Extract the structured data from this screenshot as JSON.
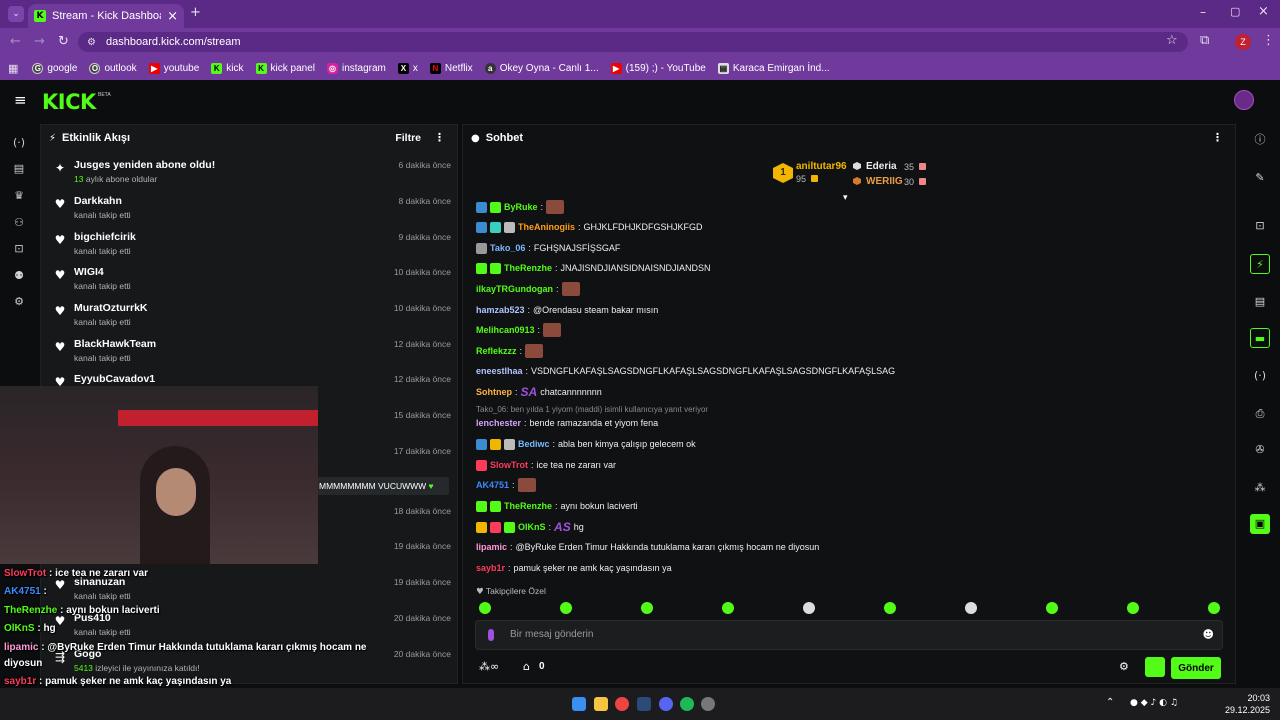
{
  "browser": {
    "tab_title": "Stream - Kick Dashboard",
    "url": "dashboard.kick.com/stream",
    "profile_letter": "Z",
    "bookmarks": [
      "google",
      "outlook",
      "youtube",
      "kick",
      "kick panel",
      "instagram",
      "x",
      "Netflix",
      "Okey Oyna - Canlı 1...",
      "(159) ;) - YouTube",
      "Karaca Emirgan İnd..."
    ]
  },
  "kick": {
    "logo": "KICK",
    "beta": "BETA"
  },
  "activity": {
    "title": "Etkinlik Akışı",
    "filter_label": "Filtre",
    "items": [
      {
        "name": "Jusges yeniden abone oldu!",
        "sub_count": "13",
        "sub": "aylık abone oldular",
        "time": "6 dakika önce",
        "icon": "sparkle-icon"
      },
      {
        "name": "Darkkahn",
        "sub": "kanalı takip etti",
        "time": "8 dakika önce",
        "icon": "heart-icon"
      },
      {
        "name": "bigchiefcirik",
        "sub": "kanalı takip etti",
        "time": "9 dakika önce",
        "icon": "heart-icon"
      },
      {
        "name": "WIGI4",
        "sub": "kanalı takip etti",
        "time": "10 dakika önce",
        "icon": "heart-icon"
      },
      {
        "name": "MuratOzturrkK",
        "sub": "kanalı takip etti",
        "time": "10 dakika önce",
        "icon": "heart-icon"
      },
      {
        "name": "BlackHawkTeam",
        "sub": "kanalı takip etti",
        "time": "12 dakika önce",
        "icon": "heart-icon"
      },
      {
        "name": "EyyubCavadov1",
        "sub": "",
        "time": "12 dakika önce",
        "icon": "heart-icon"
      },
      {
        "name": "",
        "sub": "",
        "time": "15 dakika önce",
        "icon": ""
      },
      {
        "name": "",
        "sub": "",
        "time": "17 dakika önce",
        "icon": ""
      },
      {
        "name": "",
        "sub": "",
        "time": "18 dakika önce",
        "icon": ""
      },
      {
        "name": "",
        "sub": "",
        "time": "19 dakika önce",
        "icon": ""
      },
      {
        "name": "sinanuzan",
        "sub": "kanalı takip etti",
        "time": "19 dakika önce",
        "icon": "heart-icon"
      },
      {
        "name": "Pus410",
        "sub": "kanalı takip etti",
        "time": "20 dakika önce",
        "icon": "heart-icon"
      },
      {
        "name": "Gogo",
        "sub_count": "5413",
        "sub": "izleyici ile yayınınıza katıldı!",
        "time": "20 dakika önce",
        "icon": "raid-icon"
      }
    ],
    "highlight_message": "MMMMMMMM VUCUWWW"
  },
  "chat": {
    "title": "Sohbet",
    "leaderboard": {
      "first_name": "aniltutar96",
      "first_rank": "1",
      "first_value": "95",
      "second_name": "Ederia",
      "second_value": "35",
      "third_name": "WERIIG",
      "third_value": "30"
    },
    "messages": [
      {
        "user": "ByRuke",
        "color": "#53fc18",
        "text": ""
      },
      {
        "user": "TheAninogiis",
        "color": "#ff9f1c",
        "text": "GHJKLFDHJKDFGSHJKFGD"
      },
      {
        "user": "Tako_06",
        "color": "#7ab8ff",
        "text": "FGHŞNAJSFİŞSGAF"
      },
      {
        "user": "TheRenzhe",
        "color": "#53fc18",
        "text": "JNAJISNDJIANSIDNAISNDJIANDSN"
      },
      {
        "user": "ilkayTRGundogan",
        "color": "#53fc18",
        "text": ""
      },
      {
        "user": "hamzab523",
        "color": "#b0c4ff",
        "text": "@Orendasu steam bakar mısın"
      },
      {
        "user": "Melihcan0913",
        "color": "#53fc18",
        "text": ""
      },
      {
        "user": "Reflekzzz",
        "color": "#53fc18",
        "text": ""
      },
      {
        "user": "eneestlhaa",
        "color": "#b0c4ff",
        "text": "VSDNGFLKAFAŞLSAGSDNGFLKAFAŞLSAGSDNGFLKAFAŞLSAGSDNGFLKAFAŞLSAG"
      },
      {
        "user": "Sohtnep",
        "color": "#ffb347",
        "text": "chatcannnnnnn"
      },
      {
        "user": "lenchester",
        "color": "#d6a0ff",
        "text": "bende ramazanda et yiyom fena"
      },
      {
        "user": "Bediwc",
        "color": "#7ab8ff",
        "text": "abla ben kimya çalışıp gelecem ok"
      },
      {
        "user": "SlowTrot",
        "color": "#ff3b5c",
        "text": "ice tea ne zararı var"
      },
      {
        "user": "AK4751",
        "color": "#3b8bff",
        "text": ""
      },
      {
        "user": "TheRenzhe",
        "color": "#53fc18",
        "text": "aynı bokun laciverti"
      },
      {
        "user": "OlKnS",
        "color": "#53fc18",
        "text": "hg"
      },
      {
        "user": "lipamic",
        "color": "#ff9ad6",
        "text": "@ByRuke Erden Timur Hakkında tutuklama kararı çıkmış hocam ne diyosun"
      },
      {
        "user": "sayb1r",
        "color": "#ff3b5c",
        "text": "pamuk şeker ne amk kaç yaşındasın ya"
      }
    ],
    "reply_context": "Tako_06: ben yılda 1 yiyom (maddi) isimli kullanıcıya yanıt veriyor",
    "emote_SA": "SA",
    "emote_AS": "AS",
    "followers_only": "Takipçilere Özel",
    "input_placeholder": "Bir mesaj gönderin",
    "bottom_count": "0",
    "send_label": "Gönder"
  },
  "overlay_chat": [
    {
      "user": "SlowTrot",
      "color": "#ff3b5c",
      "text": "ice tea ne zararı var"
    },
    {
      "user": "AK4751",
      "color": "#3b8bff",
      "text": ""
    },
    {
      "user": "TheRenzhe",
      "color": "#53fc18",
      "text": "aynı bokun laciverti"
    },
    {
      "user": "OlKnS",
      "color": "#53fc18",
      "text": "hg"
    },
    {
      "user": "lipamic",
      "color": "#ff9ad6",
      "text": "@ByRuke Erden Timur Hakkında tutuklama kararı çıkmış hocam ne"
    },
    {
      "user": "",
      "color": "#ffffff",
      "text": "diyosun"
    },
    {
      "user": "sayb1r",
      "color": "#ff3b5c",
      "text": "pamuk şeker ne amk kaç yaşındasın ya"
    }
  ],
  "taskbar": {
    "time": "20:03",
    "date": "29.12.2025"
  }
}
